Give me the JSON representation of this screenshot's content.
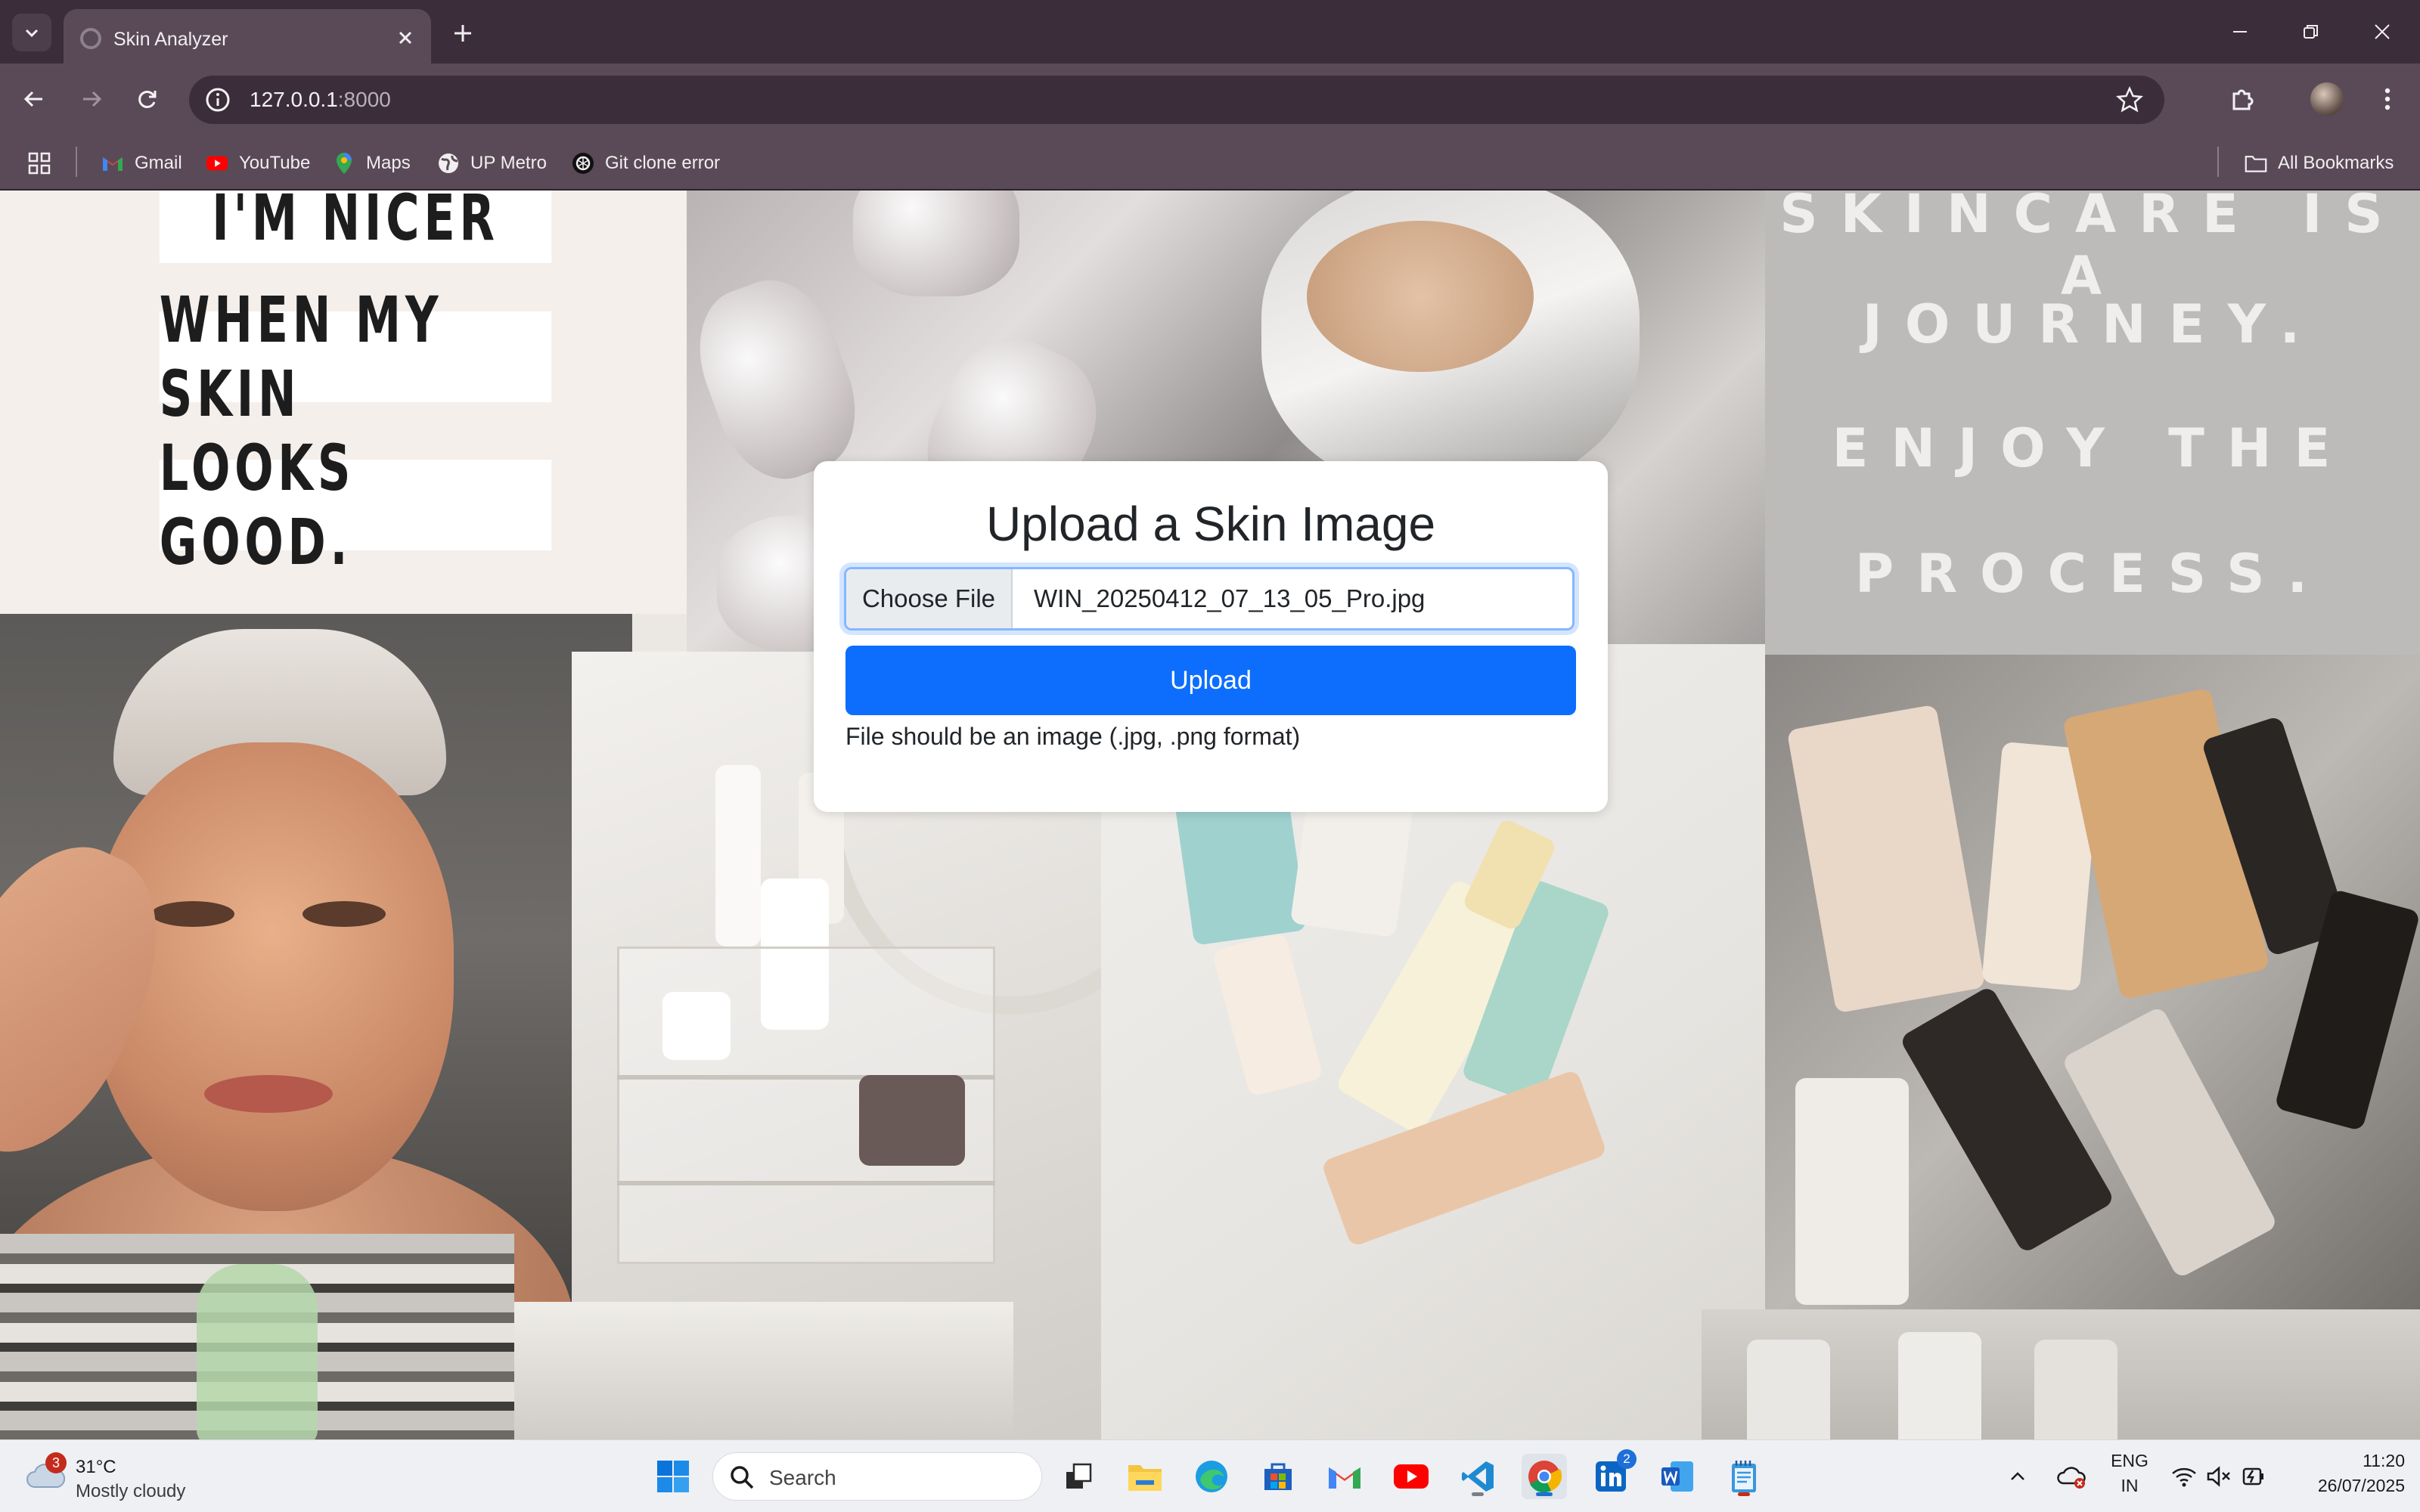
{
  "browser": {
    "tab_title": "Skin Analyzer",
    "url_host": "127.0.0.1",
    "url_port": ":8000",
    "bookmarks": [
      {
        "label": "Gmail",
        "icon": "gmail-icon"
      },
      {
        "label": "YouTube",
        "icon": "youtube-icon"
      },
      {
        "label": "Maps",
        "icon": "maps-icon"
      },
      {
        "label": "UP Metro",
        "icon": "globe-icon"
      },
      {
        "label": "Git clone error",
        "icon": "openai-icon"
      }
    ],
    "all_bookmarks_label": "All Bookmarks"
  },
  "background": {
    "quote_left": [
      "I'M NICER",
      "WHEN MY SKIN",
      "LOOKS GOOD."
    ],
    "quote_right": [
      "SKINCARE IS A",
      "JOURNEY.",
      "ENJOY THE",
      "PROCESS."
    ]
  },
  "upload_card": {
    "title": "Upload a Skin Image",
    "choose_file_label": "Choose File",
    "selected_file": "WIN_20250412_07_13_05_Pro.jpg",
    "upload_label": "Upload",
    "hint": "File should be an image (.jpg, .png format)"
  },
  "taskbar": {
    "weather_badge": "3",
    "weather_temp": "31°C",
    "weather_desc": "Mostly cloudy",
    "search_placeholder": "Search",
    "linkedin_badge": "2",
    "lang_primary": "ENG",
    "lang_secondary": "IN",
    "time": "11:20",
    "date": "26/07/2025"
  },
  "colors": {
    "chrome_frame": "#3b2e3a",
    "chrome_toolbar": "#5a4a57",
    "primary_button": "#0d6efd",
    "focus_ring": "#86b7fe"
  }
}
